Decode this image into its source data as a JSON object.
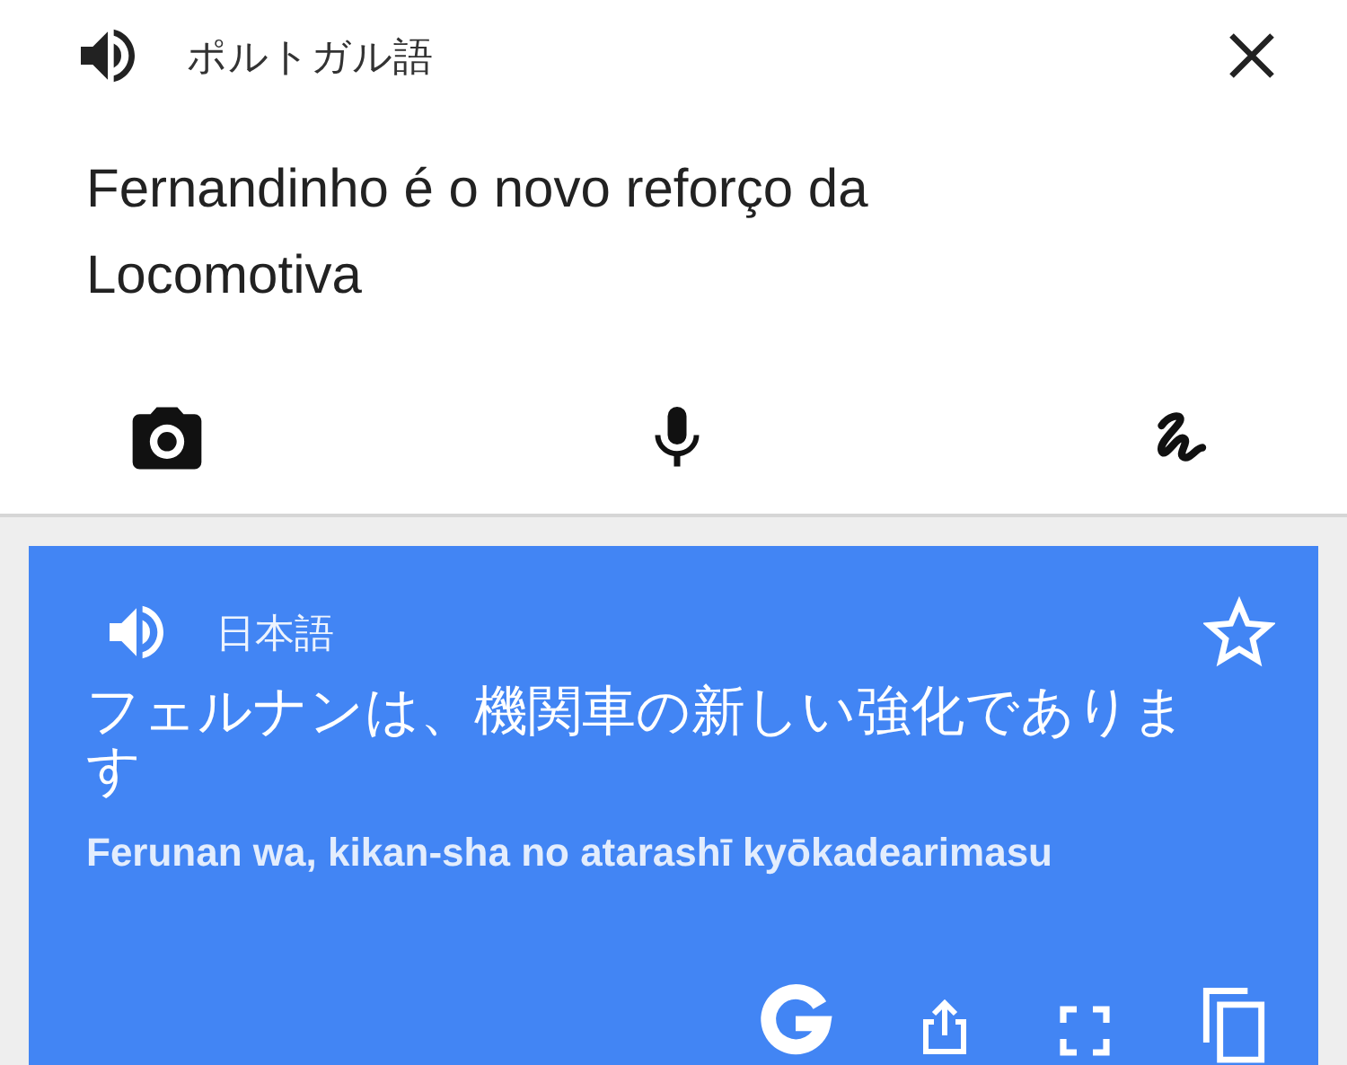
{
  "source": {
    "language": "ポルトガル語",
    "text": "Fernandinho é o novo reforço da Locomotiva"
  },
  "input_tools": [
    {
      "kind": "camera"
    },
    {
      "kind": "microphone"
    },
    {
      "kind": "handwriting"
    }
  ],
  "translation": {
    "language": "日本語",
    "starred": false,
    "text": "フェルナンは、機関車の新しい強化であります",
    "romanization": "Ferunan wa, kikan-sha no atarashī kyōkadearimasu"
  },
  "actions": [
    {
      "kind": "google"
    },
    {
      "kind": "share"
    },
    {
      "kind": "fullscreen"
    },
    {
      "kind": "copy"
    }
  ]
}
